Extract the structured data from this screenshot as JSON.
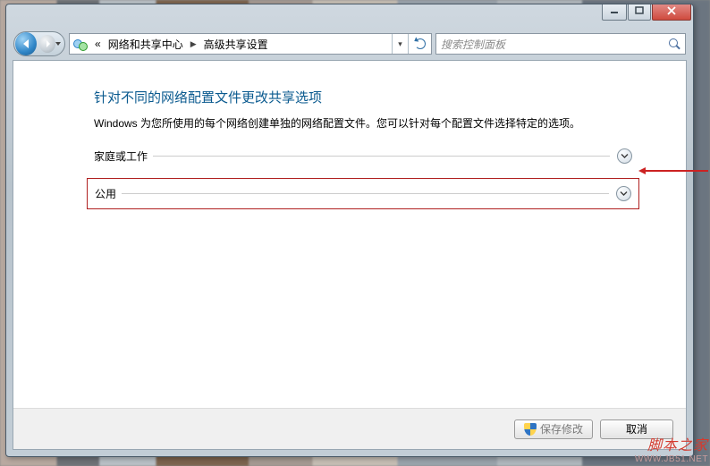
{
  "window": {
    "breadcrumb_prefix": "«",
    "breadcrumb1": "网络和共享中心",
    "breadcrumb2": "高级共享设置",
    "search_placeholder": "搜索控制面板"
  },
  "page": {
    "heading": "针对不同的网络配置文件更改共享选项",
    "description": "Windows 为您所使用的每个网络创建单独的网络配置文件。您可以针对每个配置文件选择特定的选项。",
    "sections": [
      {
        "label": "家庭或工作"
      },
      {
        "label": "公用"
      }
    ]
  },
  "footer": {
    "save": "保存修改",
    "cancel": "取消"
  },
  "watermark": {
    "line1": "脚本之家",
    "line2": "WWW.JB51.NET"
  }
}
